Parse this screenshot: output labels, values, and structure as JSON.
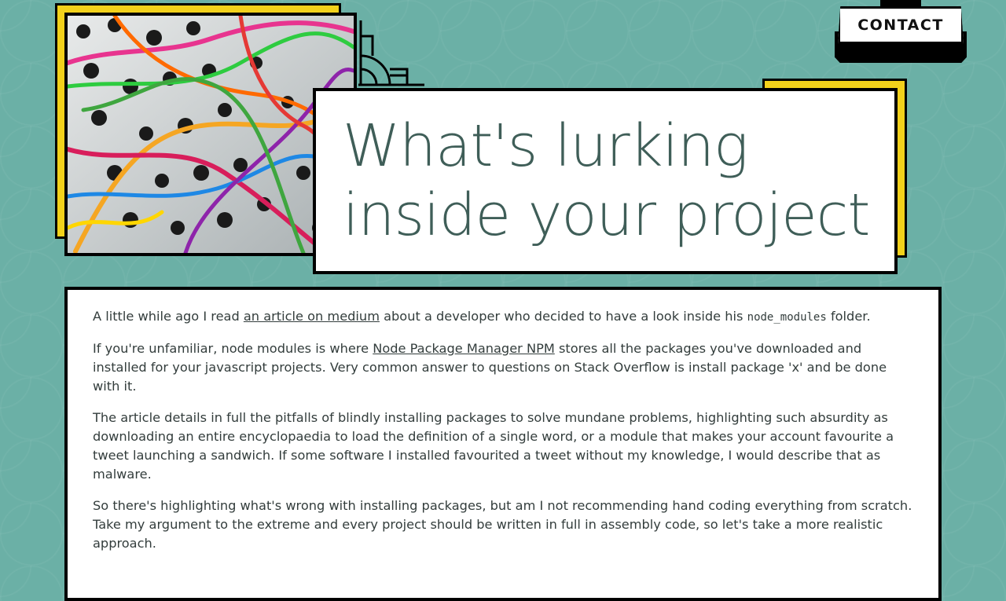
{
  "nav": {
    "contact_label": "CONTACT"
  },
  "hero": {
    "title": "What's lurking inside your project"
  },
  "article": {
    "p1": {
      "before": "A little while ago I read ",
      "link": "an article on medium",
      "middle": " about a developer who decided to have a look inside his ",
      "code": "node_modules",
      "after": " folder."
    },
    "p2": {
      "before": "If you're unfamiliar, node modules is where ",
      "link": "Node Package Manager NPM",
      "after": " stores all the packages you've downloaded and installed for your javascript projects. Very common answer to questions on Stack Overflow is install package 'x' and be done with it."
    },
    "p3": "The article details in full the pitfalls of blindly installing packages to solve mundane problems, highlighting such absurdity as downloading an entire encyclopaedia to load the definition of a single word, or a module that makes your account favourite a tweet launching a sandwich. If some software I installed favourited a tweet without my knowledge, I would describe that as malware.",
    "p4": "So there's highlighting what's wrong with installing packages, but am I not recommending hand coding everything from scratch. Take my argument to the extreme and every project should be written in full in assembly code, so let's take a more realistic approach."
  },
  "theme": {
    "accent": "#f2d11b",
    "background": "#6bb0a6",
    "text": "#3f5e58"
  }
}
